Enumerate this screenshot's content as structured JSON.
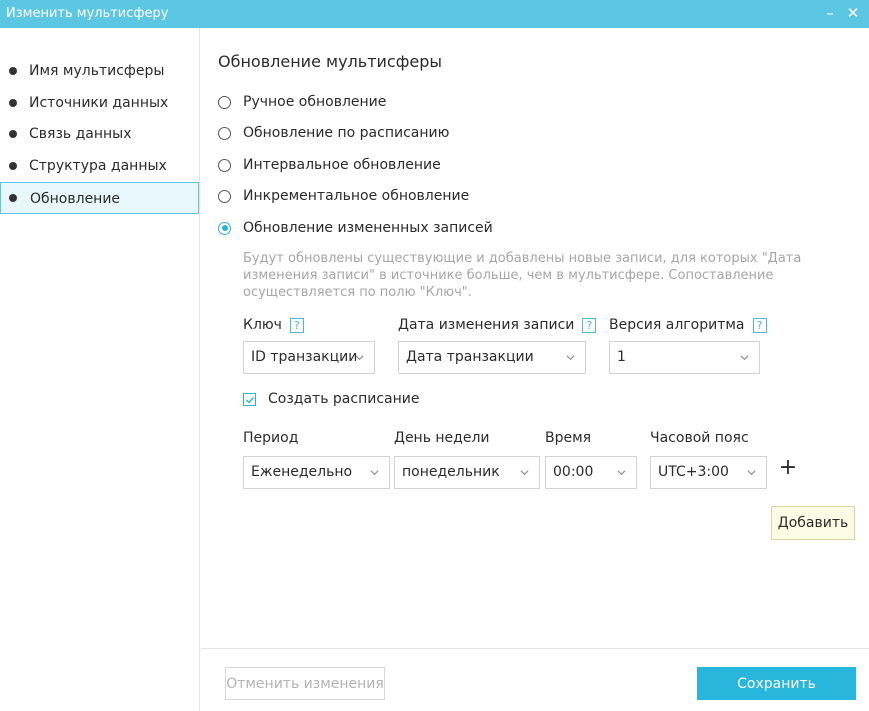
{
  "window": {
    "title": "Изменить мультисферу",
    "minimize_glyph": "–",
    "close_glyph": "✕",
    "accent": "#5bc7e2"
  },
  "sidebar": {
    "items": [
      {
        "label": "Имя мультисферы",
        "active": false
      },
      {
        "label": "Источники данных",
        "active": false
      },
      {
        "label": "Связь данных",
        "active": false
      },
      {
        "label": "Структура данных",
        "active": false
      },
      {
        "label": "Обновление",
        "active": true
      }
    ]
  },
  "main": {
    "title": "Обновление мультисферы",
    "update_modes": [
      {
        "label": "Ручное обновление",
        "checked": false
      },
      {
        "label": "Обновление по расписанию",
        "checked": false
      },
      {
        "label": "Интервальное обновление",
        "checked": false
      },
      {
        "label": "Инкрементальное обновление",
        "checked": false
      },
      {
        "label": "Обновление измененных записей",
        "checked": true
      }
    ],
    "hint": "Будут обновлены существующие и добавлены новые записи, для которых \"Дата изменения записи\" в источнике больше, чем в мультисфере. Сопоставление осуществляется по полю \"Ключ\".",
    "fields": {
      "key": {
        "label": "Ключ",
        "value": "ID транзакции"
      },
      "modified_date": {
        "label": "Дата изменения записи",
        "value": "Дата транзакции"
      },
      "algorithm": {
        "label": "Версия алгоритма",
        "value": "1"
      }
    },
    "help_glyph": "?",
    "create_schedule": {
      "label": "Создать расписание",
      "checked": true
    },
    "schedule": {
      "period": {
        "label": "Период",
        "value": "Еженедельно"
      },
      "weekday": {
        "label": "День недели",
        "value": "понедельник"
      },
      "time": {
        "label": "Время",
        "value": "00:00"
      },
      "timezone": {
        "label": "Часовой пояс",
        "value": "UTC+3:00"
      }
    },
    "add_glyph": "+",
    "add_tooltip": "Добавить"
  },
  "footer": {
    "cancel_label": "Отменить изменения",
    "save_label": "Сохранить"
  },
  "colors": {
    "accent": "#29b6dc",
    "hint_text": "#a6a6a6",
    "tooltip_bg": "#fcfce4"
  }
}
